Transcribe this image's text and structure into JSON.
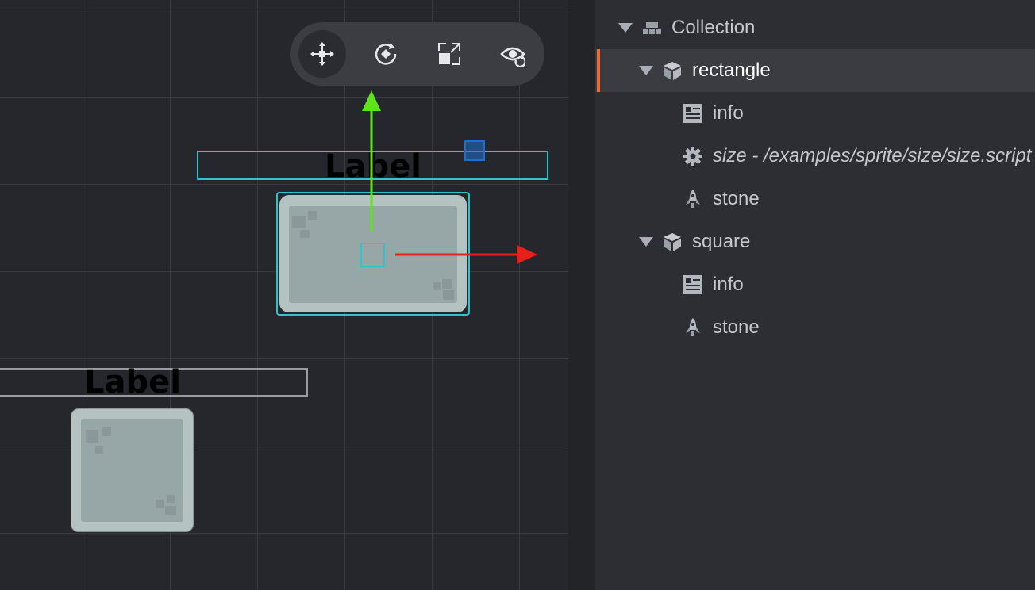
{
  "viewport": {
    "toolbar": {
      "tools": [
        {
          "name": "move-tool",
          "icon": "move-icon",
          "active": true
        },
        {
          "name": "rotate-tool",
          "icon": "rotate-icon",
          "active": false
        },
        {
          "name": "scale-tool",
          "icon": "scale-icon",
          "active": false
        },
        {
          "name": "visibility-tool",
          "icon": "eye-refresh-icon",
          "active": false
        }
      ]
    },
    "objects": {
      "rectangle_label": "Label",
      "square_label": "Label"
    },
    "colors": {
      "selection": "#2ec4c8",
      "axis_x": "#e8201c",
      "axis_y": "#5fe31c",
      "handle_blue": "#1b6fd1"
    }
  },
  "outline": {
    "items": [
      {
        "label": "Collection",
        "icon": "collection-icon",
        "expanded": true
      },
      {
        "label": "rectangle",
        "icon": "game-object-icon",
        "expanded": true,
        "selected": true
      },
      {
        "label": "info",
        "icon": "label-component-icon"
      },
      {
        "label": "size - /examples/sprite/size/size.script",
        "icon": "script-gear-icon"
      },
      {
        "label": "stone",
        "icon": "sprite-rocket-icon"
      },
      {
        "label": "square",
        "icon": "game-object-icon",
        "expanded": true
      },
      {
        "label": "info",
        "icon": "label-component-icon"
      },
      {
        "label": "stone",
        "icon": "sprite-rocket-icon"
      }
    ],
    "accent": "#e96a3c"
  }
}
